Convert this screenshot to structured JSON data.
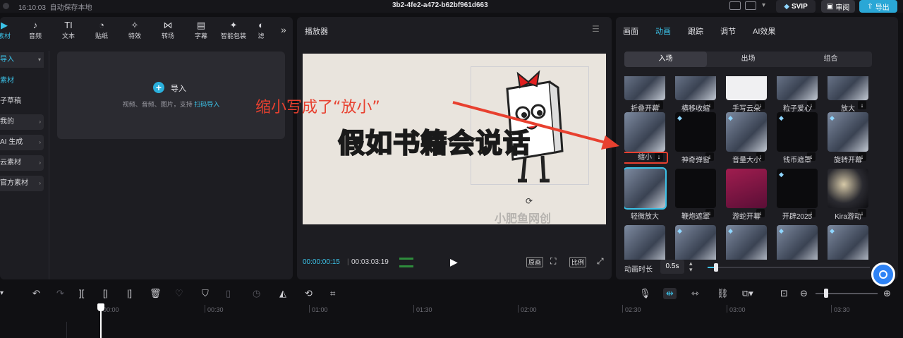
{
  "titlebar": {
    "time": "16:10:03",
    "autosave": "自动保存本地",
    "project_title": "3b2-4fe2-a472-b62bf961d663",
    "svip": "SVIP",
    "review": "审阅",
    "export": "导出"
  },
  "left": {
    "tabs": [
      "素材",
      "音频",
      "文本",
      "贴纸",
      "特效",
      "转场",
      "字幕",
      "智能包装",
      "滤"
    ],
    "sidebar": [
      "导入",
      "素材",
      "子草稿",
      "我的",
      "AI 生成",
      "云素材",
      "官方素材"
    ],
    "import_label": "导入",
    "import_hint": "视频、音频、图片，支持",
    "import_link": "扫码导入"
  },
  "player": {
    "title": "播放器",
    "video_title": "假如书籍会说话",
    "watermark": "小肥鱼网创",
    "time_current": "00:00:00:15",
    "time_total": "00:03:03:19",
    "btn_original": "原画",
    "btn_ratio": "比例"
  },
  "annotation": {
    "text": "缩小写成了“放小”",
    "color": "#e8402f"
  },
  "right": {
    "tabs": [
      "画面",
      "动画",
      "跟踪",
      "调节",
      "AI效果"
    ],
    "active_tab": "动画",
    "subtabs": [
      "入场",
      "出场",
      "组合"
    ],
    "active_subtab": "入场",
    "effects": [
      [
        "折叠开幕",
        "横移收缩",
        "手写云朵",
        "粒子爱心",
        "放大"
      ],
      [
        "缩小",
        "神奇弹窗",
        "音量大小",
        "钱币遮罩",
        "旋转开幕"
      ],
      [
        "轻微放大",
        "鞭炮遮罩",
        "游蛇开幕",
        "开辟2025",
        "Kira游动"
      ],
      [
        "",
        "",
        "",
        "",
        ""
      ]
    ],
    "selected_effect": "轻微放大",
    "highlighted_effect": "缩小",
    "duration_label": "动画时长",
    "duration_value": "0.5s",
    "duration_fraction": 0.05
  },
  "timeline": {
    "ticks": [
      "00:00",
      "00:30",
      "01:00",
      "01:30",
      "02:00",
      "02:30",
      "03:00",
      "03:30"
    ]
  },
  "colors": {
    "accent": "#3bc2e8",
    "export_button": "#2aa7d6",
    "annotation_red": "#e8402f"
  }
}
